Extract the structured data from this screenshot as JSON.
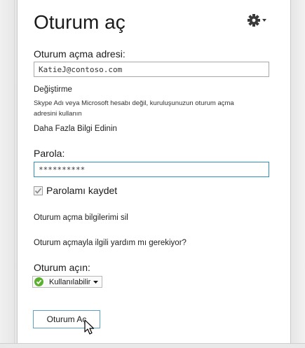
{
  "header": {
    "title": "Oturum aç"
  },
  "address": {
    "label": "Oturum açma adresi:",
    "value": "KatieJ@contoso.com",
    "change_link": "Değiştirme",
    "hint": "Skype Adı veya Microsoft hesabı değil, kuruluşunuzun oturum açma adresini kullanın",
    "more_info_link": "Daha Fazla Bilgi Edinin"
  },
  "password": {
    "label": "Parola:",
    "value": "**********",
    "save_label": "Parolamı kaydet",
    "save_checked": true
  },
  "links": {
    "delete_info": "Oturum açma bilgilerimi sil",
    "help": "Oturum açmayla ilgili yardım mı gerekiyor?"
  },
  "status": {
    "label": "Oturum açın:",
    "selected": "Kullanılabilir",
    "color": "#5cb030"
  },
  "actions": {
    "signin_label": "Oturum Aç"
  },
  "icons": {
    "settings": "gear-icon",
    "dropdown": "caret-down-icon",
    "check": "checkmark-icon",
    "status": "available-status-icon",
    "cursor": "mouse-pointer-icon"
  }
}
